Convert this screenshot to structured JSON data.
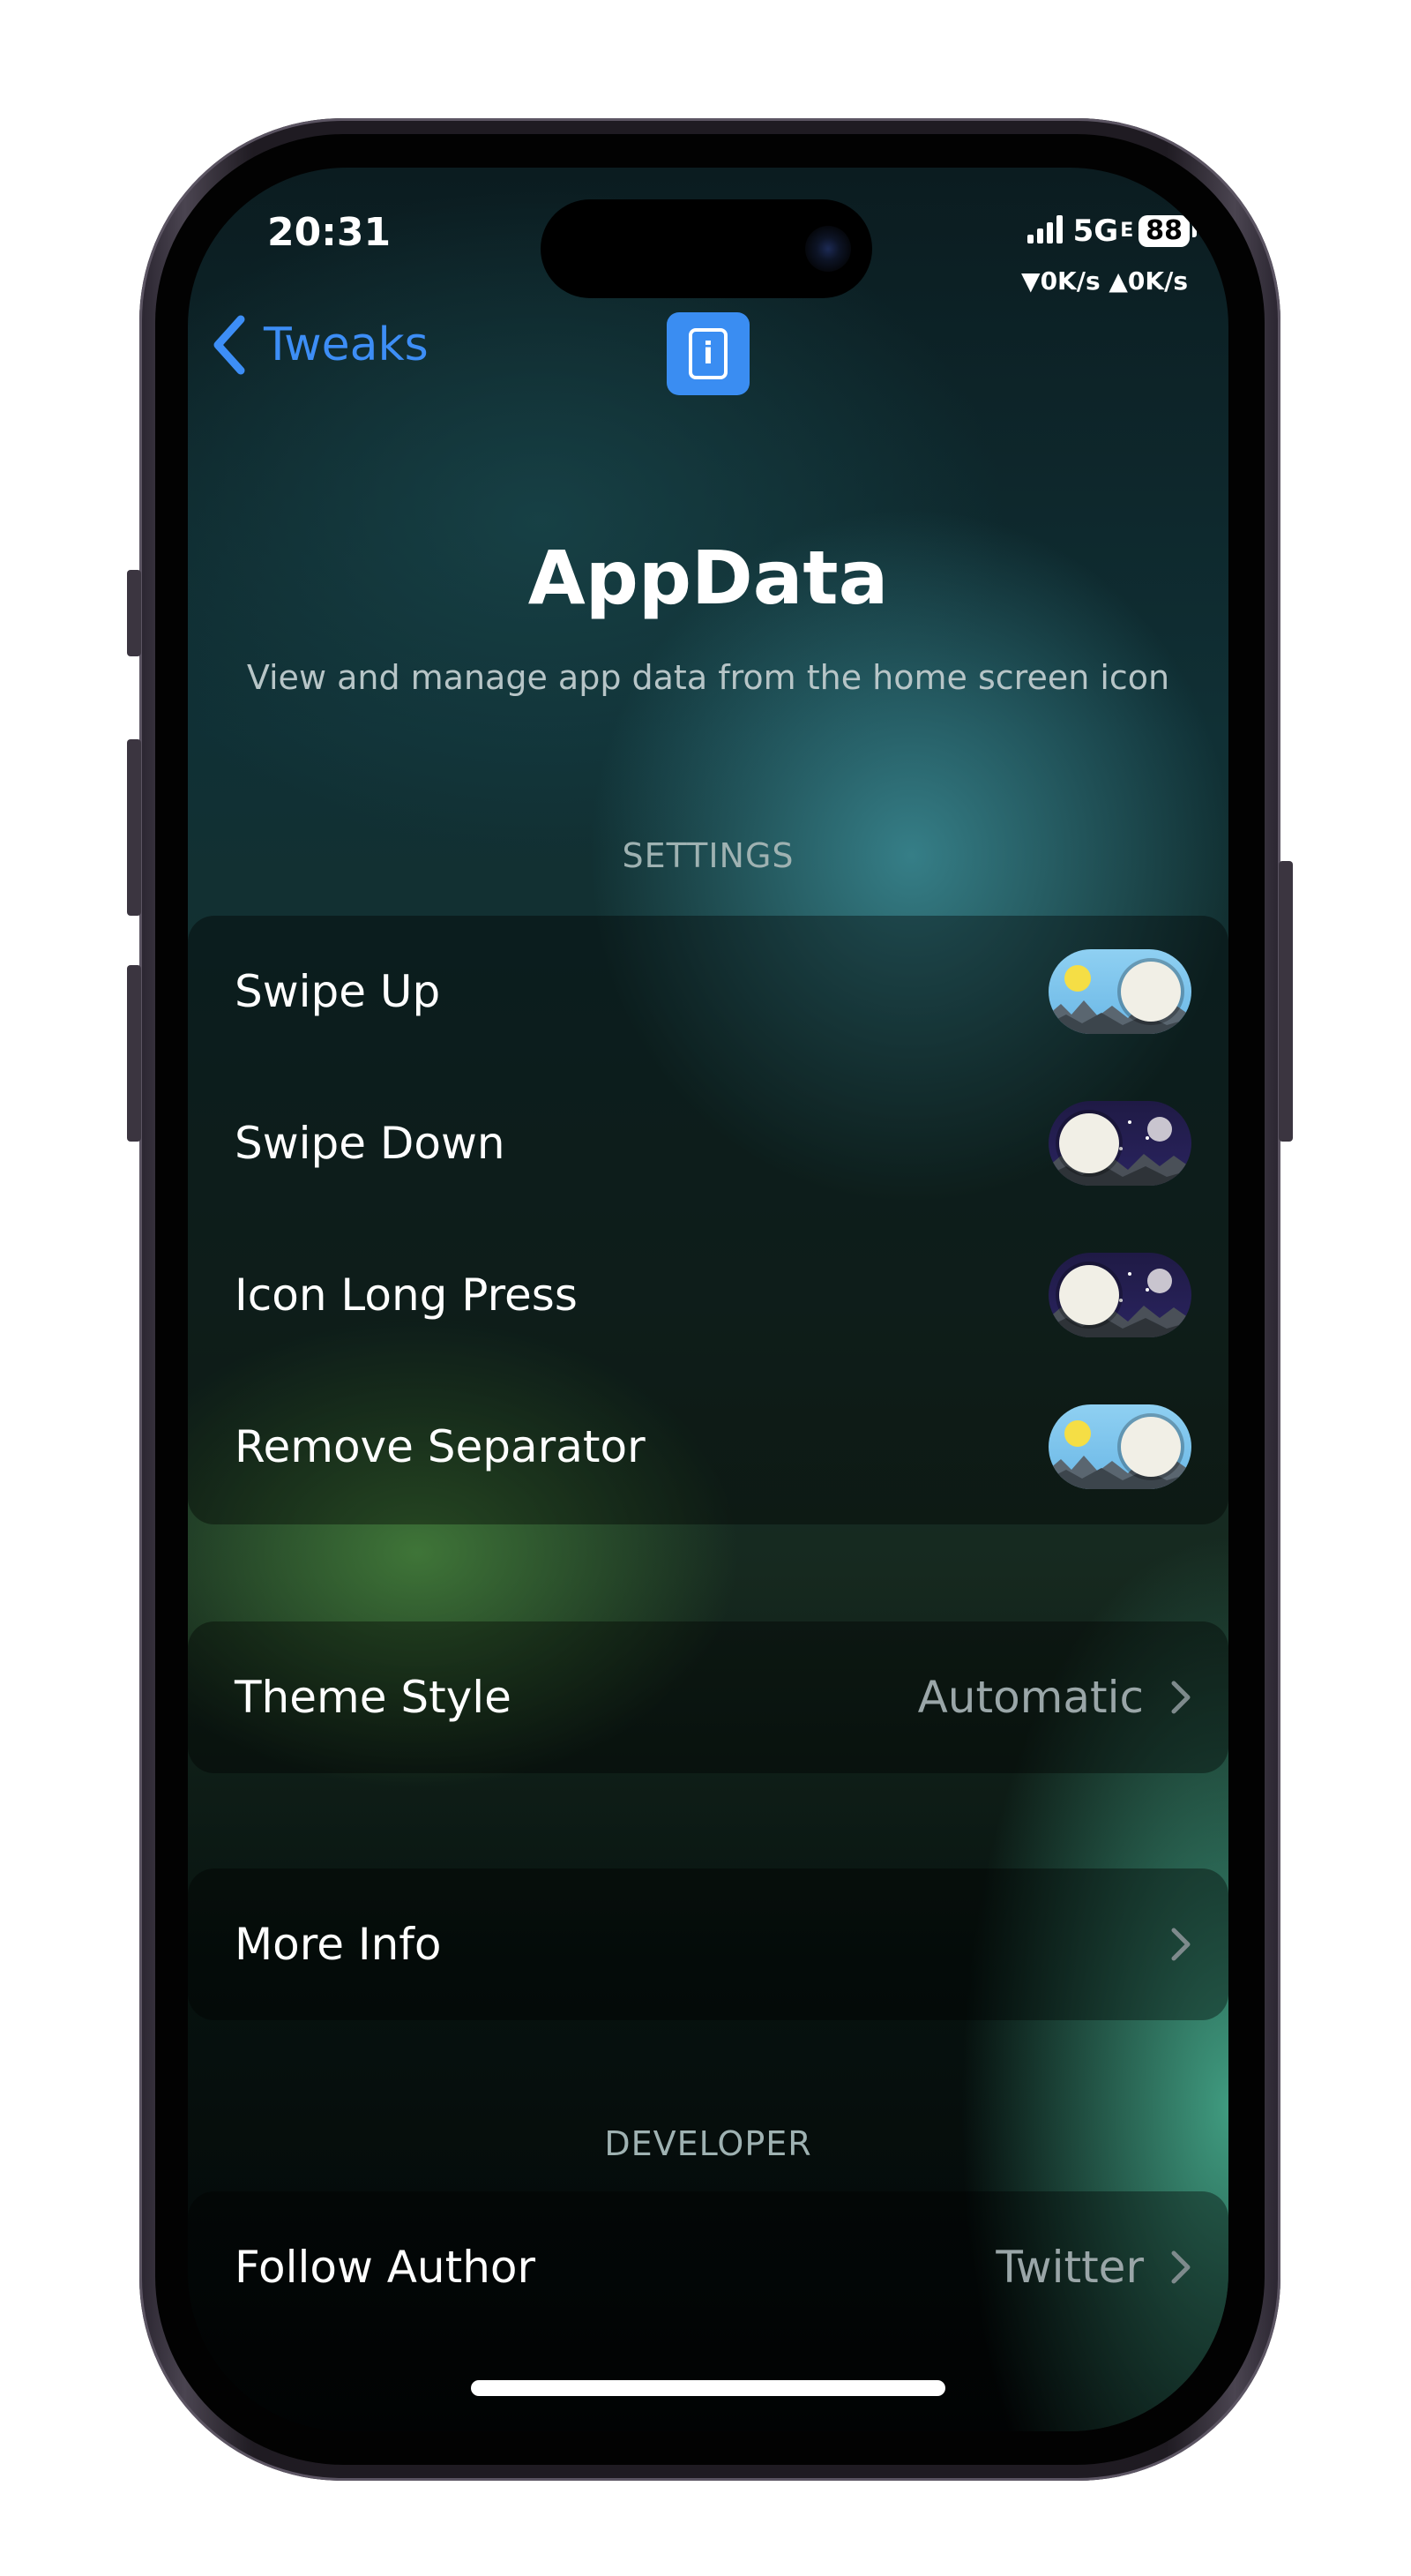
{
  "status_bar": {
    "time": "20:31",
    "network": "5G",
    "network_sub": "E",
    "battery": "88",
    "speed": "▼0K/s ▲0K/s"
  },
  "nav": {
    "back_label": "Tweaks",
    "info_icon": "info-icon"
  },
  "header": {
    "title": "AppData",
    "subtitle": "View and manage app data from the home screen icon"
  },
  "settings": {
    "section_label": "SETTINGS",
    "items": [
      {
        "label": "Swipe Up",
        "on": true
      },
      {
        "label": "Swipe Down",
        "on": false
      },
      {
        "label": "Icon Long Press",
        "on": false
      },
      {
        "label": "Remove Separator",
        "on": true
      }
    ]
  },
  "theme": {
    "label": "Theme Style",
    "value": "Automatic"
  },
  "more_info": {
    "label": "More Info"
  },
  "developer": {
    "section_label": "DEVELOPER",
    "follow_label": "Follow Author",
    "follow_value": "Twitter"
  },
  "colors": {
    "accent": "#3d8ef6",
    "toggle_day": "#7cc4ec",
    "toggle_night": "#241f52"
  }
}
